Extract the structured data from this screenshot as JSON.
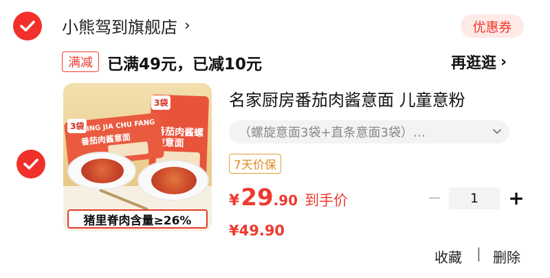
{
  "colors": {
    "accent": "#f2302b",
    "coupon_bg": "#fde9e6",
    "guarantee": "#e18922"
  },
  "store": {
    "name": "小熊驾到旗舰店",
    "chevron": "›",
    "coupon_label": "优惠券"
  },
  "promo": {
    "tag": "满减",
    "text": "已满49元，已减10元",
    "browse_more": "再逛逛",
    "chevron": "›"
  },
  "product": {
    "image": {
      "bag_count_left": "3袋",
      "bag_count_right": "3袋",
      "brand": "MING JIA CHU FANG",
      "pack_front_title": "番茄肉酱意面",
      "pack_back_title": "番茄肉酱螺旋意面",
      "banner": "猪里脊肉含量≥26%"
    },
    "title": "名家厨房番茄肉酱意面 儿童意粉",
    "sku": "（螺旋意面3袋+直条意面3袋）…",
    "guarantee": "7天价保",
    "price_symbol": "¥",
    "price_int": "29",
    "price_dec": ".90",
    "price_label": "到手价",
    "original_price": "¥49.90",
    "quantity": "1",
    "qty_minus": "−",
    "qty_plus": "+"
  },
  "actions": {
    "favorite": "收藏",
    "divider": "|",
    "delete": "删除"
  },
  "icons": {
    "store_check": "check-circle-icon",
    "item_check": "check-circle-icon",
    "sku_dropdown": "chevron-down-icon"
  }
}
